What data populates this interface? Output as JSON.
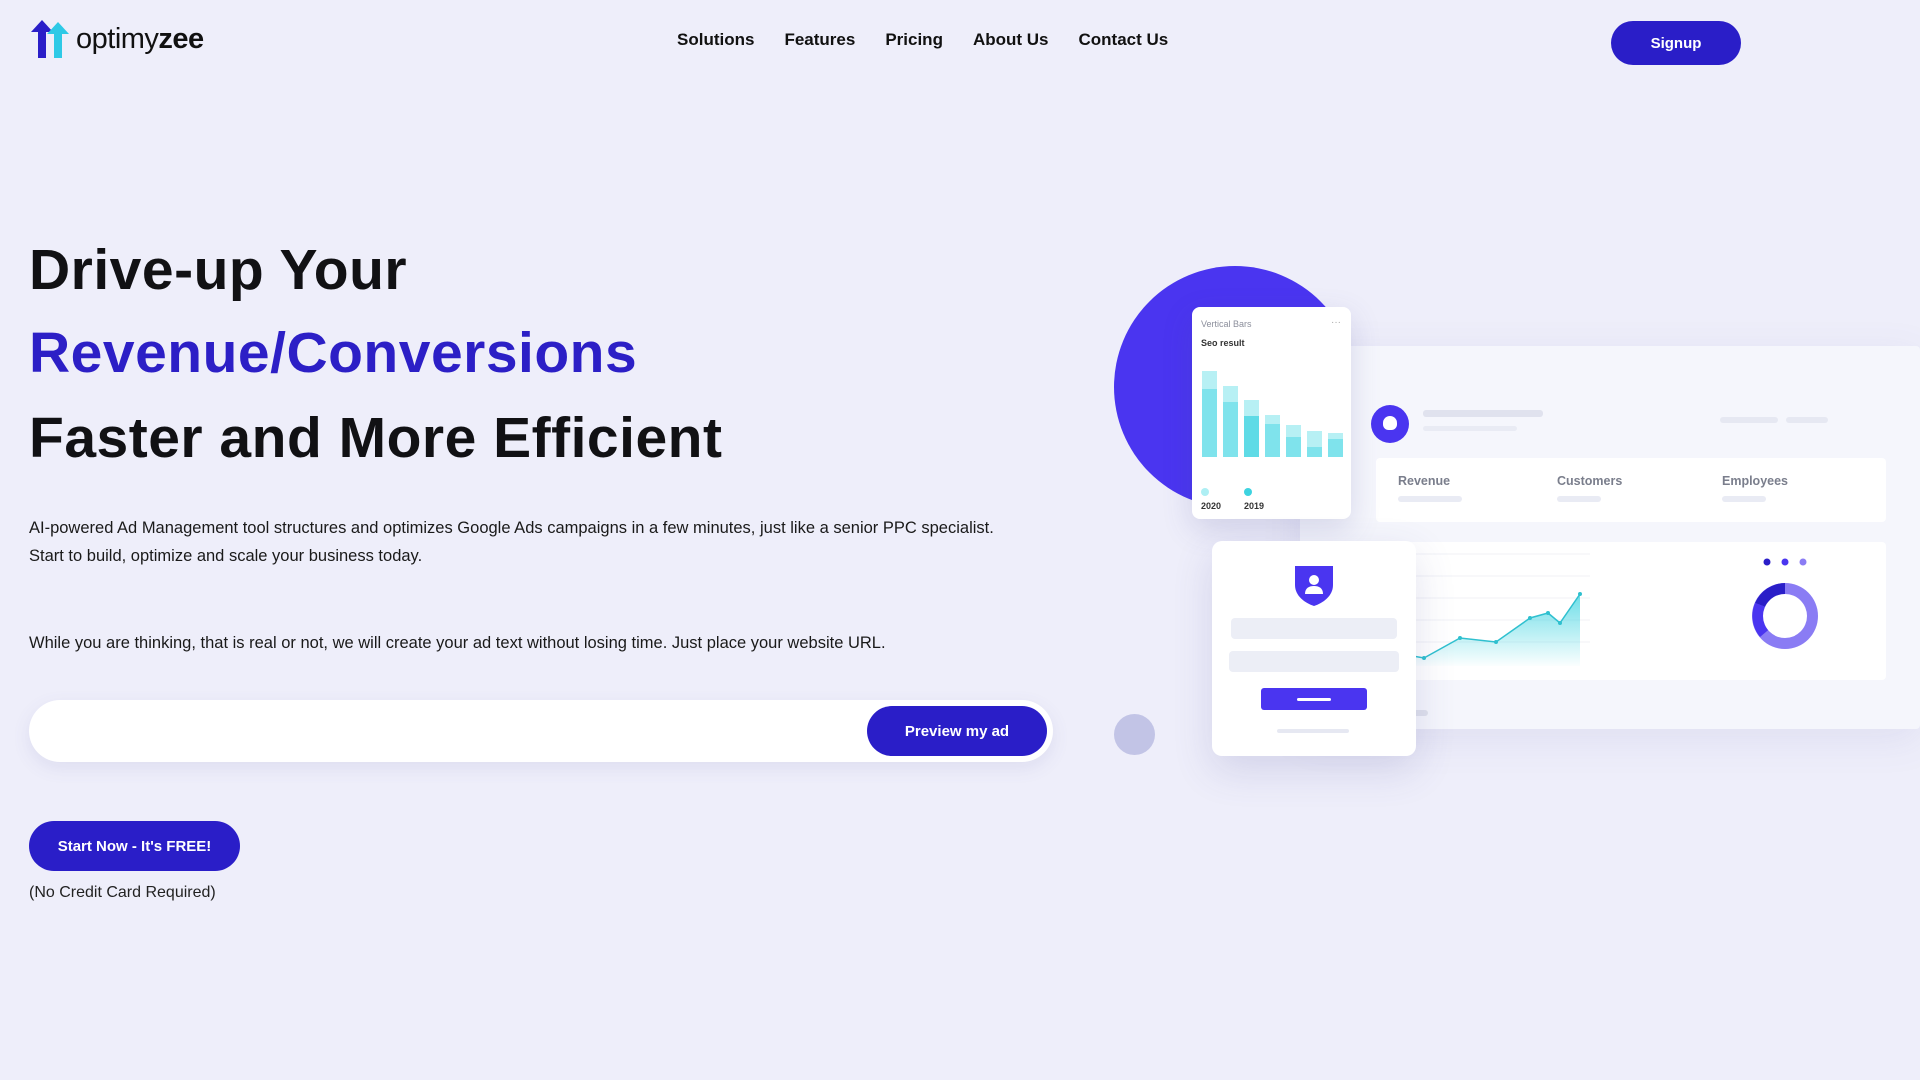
{
  "brand": {
    "name_light": "optimy",
    "name_bold": "zee",
    "logo_colors": {
      "left_arrow": "#2a1ec8",
      "right_arrow": "#2ec9e6"
    }
  },
  "nav": {
    "items": [
      {
        "label": "Solutions"
      },
      {
        "label": "Features"
      },
      {
        "label": "Pricing"
      },
      {
        "label": "About Us"
      },
      {
        "label": "Contact Us"
      }
    ],
    "signup_label": "Signup"
  },
  "hero": {
    "line1": "Drive-up Your",
    "line2": "Revenue/Conversions",
    "line3": "Faster and More Efficient",
    "description_line1": "AI-powered Ad Management tool structures and optimizes Google Ads campaigns in a few minutes, just like a senior PPC specialist.",
    "description_line2": "Start to build, optimize and scale your business today.",
    "prompt": "While you are thinking, that is real or not, we will create your ad text without losing time. Just place your website URL.",
    "url_input": {
      "value": "",
      "placeholder": ""
    },
    "preview_label": "Preview my ad",
    "start_label": "Start Now - It's FREE!",
    "no_credit_card": "(No Credit Card Required)"
  },
  "illustration": {
    "bars_card": {
      "title": "Vertical Bars",
      "subtitle": "Seo result",
      "menu_glyph": "···",
      "legend": [
        {
          "label": "2020",
          "color": "#aeeff4"
        },
        {
          "label": "2019",
          "color": "#3dd3e0"
        }
      ]
    },
    "stats": [
      "Revenue",
      "Customers",
      "Employees"
    ],
    "colors": {
      "accent": "#4a35f0",
      "teal": "#3dd3e0",
      "teal_light": "#b7f0f4"
    }
  }
}
